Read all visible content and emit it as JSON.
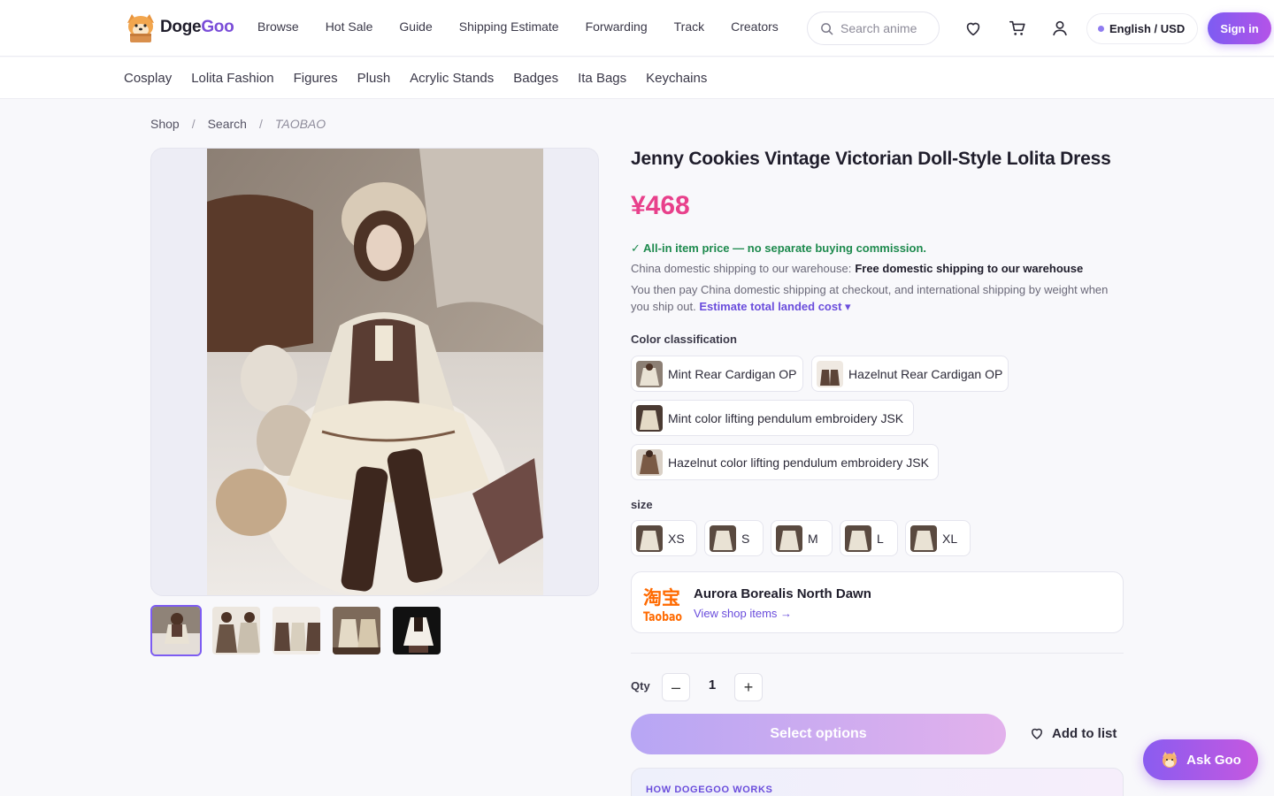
{
  "header": {
    "logo_part1": "Doge",
    "logo_part2": "Goo",
    "nav": [
      "Browse",
      "Hot Sale",
      "Guide",
      "Shipping Estimate",
      "Forwarding",
      "Track",
      "Creators"
    ],
    "search_placeholder": "Search anime",
    "language": "English / USD",
    "signin": "Sign in"
  },
  "categories": [
    "Cosplay",
    "Lolita Fashion",
    "Figures",
    "Plush",
    "Acrylic Stands",
    "Badges",
    "Ita Bags",
    "Keychains"
  ],
  "breadcrumb": [
    "Shop",
    "Search",
    "TAOBAO"
  ],
  "breadcrumb_sep": "/",
  "product": {
    "title": "Jenny Cookies Vintage Victorian Doll-Style Lolita Dress",
    "price": "¥468",
    "all_in": "✓ All-in item price — no separate buying commission.",
    "shipping_label": "China domestic shipping to our warehouse:",
    "shipping_value": "Free domestic shipping to our warehouse",
    "note": "You then pay China domestic shipping at checkout, and international shipping by weight when you ship out.",
    "estimate_link": "Estimate total landed cost ▾"
  },
  "options": {
    "color_label": "Color classification",
    "colors": [
      "Mint Rear Cardigan OP",
      "Hazelnut Rear Cardigan OP",
      "Mint color lifting pendulum embroidery JSK",
      "Hazelnut color lifting pendulum embroidery JSK"
    ],
    "size_label": "size",
    "sizes": [
      "XS",
      "S",
      "M",
      "L",
      "XL"
    ]
  },
  "shop": {
    "logo_text_top": "淘宝",
    "logo_text_bottom": "Taobao",
    "name": "Aurora Borealis North Dawn",
    "link": "View shop items →"
  },
  "purchase": {
    "qty_label": "Qty",
    "minus": "–",
    "qty": "1",
    "plus": "+",
    "select": "Select options",
    "add_to_list": "Add to list"
  },
  "how": "HOW DOGEGOO WORKS",
  "ask": "Ask Goo",
  "colors": {
    "accent": "#7d5cf2",
    "price": "#e8408b",
    "success": "#1e8a4e"
  }
}
